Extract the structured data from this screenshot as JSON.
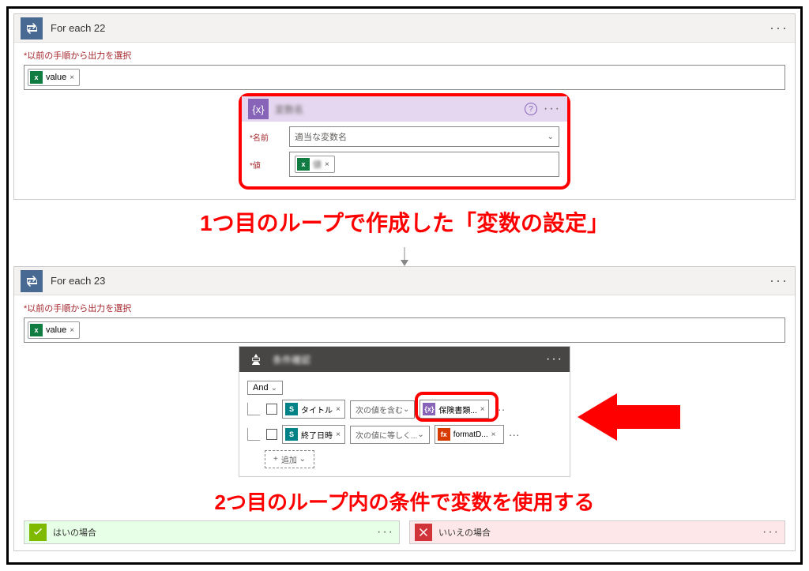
{
  "loop1": {
    "title": "For each 22",
    "field_label": "以前の手順から出力を選択",
    "token_label": "value",
    "menu": "···"
  },
  "variable_card": {
    "title": "変数名",
    "name_label": "名前",
    "name_value": "適当な変数名",
    "value_label": "値",
    "value_token": "値",
    "menu": "···"
  },
  "annotation1": "1つ目のループで作成した「変数の設定」",
  "loop2": {
    "title": "For each 23",
    "field_label": "以前の手順から出力を選択",
    "token_label": "value",
    "menu": "···"
  },
  "condition": {
    "title": "条件確認",
    "and_label": "And",
    "row1": {
      "left_token": "タイトル",
      "op": "次の値を含む",
      "right_token": "保険書類..."
    },
    "row2": {
      "left_token": "終了日時",
      "op": "次の値に等しく...",
      "right_token": "formatD..."
    },
    "add_label": "追加",
    "menu": "···"
  },
  "annotation2": "2つ目のループ内の条件で変数を使用する",
  "branch_yes": {
    "title": "はいの場合",
    "menu": "···"
  },
  "branch_no": {
    "title": "いいえの場合",
    "menu": "···"
  }
}
